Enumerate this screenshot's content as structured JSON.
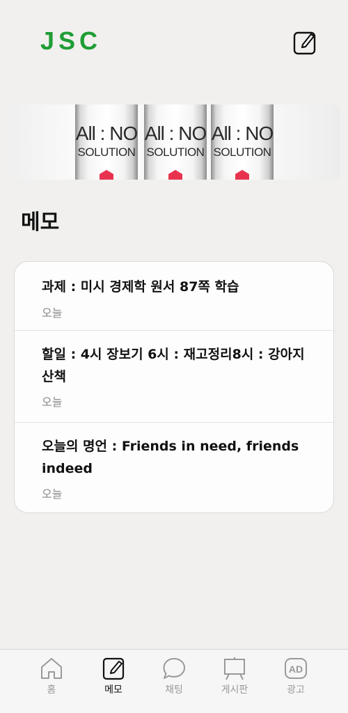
{
  "app": {
    "logo": "JSC"
  },
  "banner": {
    "tubes": [
      {
        "line1": "All : NO",
        "line2": "SOLUTION"
      },
      {
        "line1": "All : NO",
        "line2": "SOLUTION"
      },
      {
        "line1": "All : NO",
        "line2": "SOLUTION"
      }
    ]
  },
  "section": {
    "title": "메모"
  },
  "memos": [
    {
      "title": "과제 : 미시 경제학 원서 87쪽 학습",
      "date": "오늘"
    },
    {
      "title": "할일 : 4시 장보기 6시 : 재고정리8시 : 강아지 산책",
      "date": "오늘"
    },
    {
      "title": "오늘의 명언 : Friends in need, friends indeed",
      "date": "오늘"
    }
  ],
  "tabs": [
    {
      "label": "홈",
      "icon": "home-icon",
      "active": false
    },
    {
      "label": "메모",
      "icon": "memo-icon",
      "active": true
    },
    {
      "label": "채팅",
      "icon": "chat-icon",
      "active": false
    },
    {
      "label": "게시판",
      "icon": "board-icon",
      "active": false
    },
    {
      "label": "광고",
      "icon": "ad-icon",
      "active": false
    }
  ],
  "colors": {
    "brand": "#1f9d35",
    "background": "#f1f0ee",
    "banner_accent": "#e8334f"
  }
}
